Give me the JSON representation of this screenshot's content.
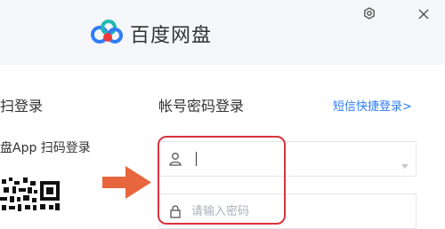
{
  "header": {
    "app_name": "百度网盘",
    "brand_colors": {
      "blue": "#2f7df6",
      "red": "#ee3a3b",
      "teal": "#1fbab0"
    }
  },
  "window_controls": {
    "settings_icon": "gear-icon",
    "close_icon": "close-icon"
  },
  "qr_login": {
    "title": "扫登录",
    "hint": "盘App 扫码登录"
  },
  "account_login": {
    "title": "帐号密码登录",
    "sms_link": "短信快捷登录>",
    "username": {
      "value": "",
      "placeholder": "",
      "icon": "user-icon",
      "dropdown_icon": "caret-down-icon"
    },
    "password": {
      "value": "",
      "placeholder": "请输入密码",
      "icon": "lock-icon"
    }
  },
  "annotation": {
    "arrow_color": "#e8663d",
    "highlight_color": "#d9323f"
  }
}
